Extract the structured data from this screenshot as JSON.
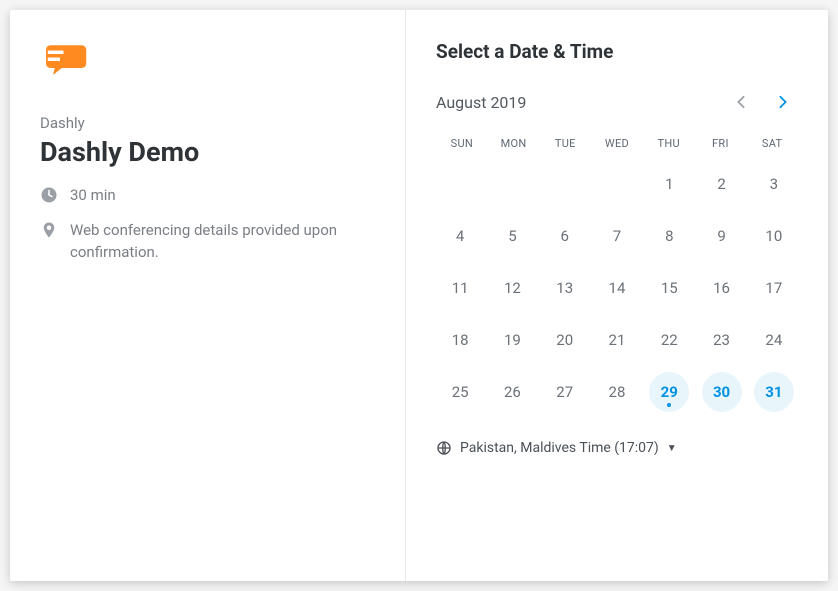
{
  "provider": "Dashly",
  "title": "Dashly Demo",
  "duration_label": "30 min",
  "location_label": "Web conferencing details provided upon confirmation.",
  "section_title": "Select a Date & Time",
  "month_label": "August 2019",
  "dow": [
    "SUN",
    "MON",
    "TUE",
    "WED",
    "THU",
    "FRI",
    "SAT"
  ],
  "calendar": {
    "leading_blanks": 4,
    "days": [
      {
        "n": 1
      },
      {
        "n": 2
      },
      {
        "n": 3
      },
      {
        "n": 4
      },
      {
        "n": 5
      },
      {
        "n": 6
      },
      {
        "n": 7
      },
      {
        "n": 8
      },
      {
        "n": 9
      },
      {
        "n": 10
      },
      {
        "n": 11
      },
      {
        "n": 12
      },
      {
        "n": 13
      },
      {
        "n": 14
      },
      {
        "n": 15
      },
      {
        "n": 16
      },
      {
        "n": 17
      },
      {
        "n": 18
      },
      {
        "n": 19
      },
      {
        "n": 20
      },
      {
        "n": 21
      },
      {
        "n": 22
      },
      {
        "n": 23
      },
      {
        "n": 24
      },
      {
        "n": 25
      },
      {
        "n": 26
      },
      {
        "n": 27
      },
      {
        "n": 28
      },
      {
        "n": 29,
        "available": true,
        "today": true
      },
      {
        "n": 30,
        "available": true
      },
      {
        "n": 31,
        "available": true
      }
    ]
  },
  "timezone_label": "Pakistan, Maldives Time (17:07)"
}
